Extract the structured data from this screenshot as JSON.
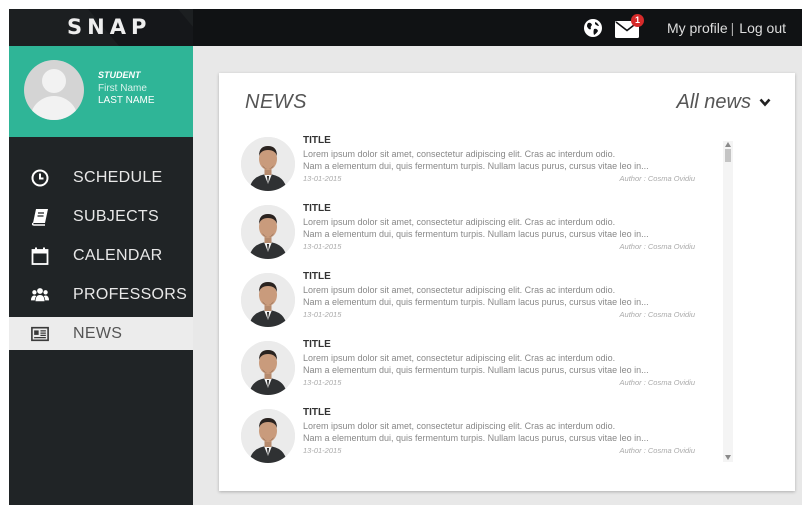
{
  "app": {
    "logo": "SNAP"
  },
  "topbar": {
    "globe_icon": "globe-icon",
    "mail_icon": "mail-icon",
    "notification_count": "1",
    "my_profile_label": "My profile",
    "separator": "|",
    "logout_label": "Log out"
  },
  "profile": {
    "role": "STUDENT",
    "first_name": "First Name",
    "last_name": "LAST NAME"
  },
  "sidebar": {
    "items": [
      {
        "label": "SCHEDULE",
        "icon": "clock-icon"
      },
      {
        "label": "SUBJECTS",
        "icon": "book-icon"
      },
      {
        "label": "CALENDAR",
        "icon": "calendar-icon"
      },
      {
        "label": "PROFESSORS",
        "icon": "users-icon"
      },
      {
        "label": "NEWS",
        "icon": "newspaper-icon",
        "active": true
      }
    ]
  },
  "main": {
    "title": "NEWS",
    "filter_label": "All news",
    "news": [
      {
        "title": "TITLE",
        "line1": "Lorem ipsum dolor sit amet, consectetur adipiscing elit. Cras ac interdum odio.",
        "line2": "Nam a elementum dui, quis fermentum turpis. Nullam lacus purus, cursus vitae leo in...",
        "date": "13-01-2015",
        "author": "Author : Cosma Ovidiu"
      },
      {
        "title": "TITLE",
        "line1": "Lorem ipsum dolor sit amet, consectetur adipiscing elit. Cras ac interdum odio.",
        "line2": "Nam a elementum dui, quis fermentum turpis. Nullam lacus purus, cursus vitae leo in...",
        "date": "13-01-2015",
        "author": "Author : Cosma Ovidiu"
      },
      {
        "title": "TITLE",
        "line1": "Lorem ipsum dolor sit amet, consectetur adipiscing elit. Cras ac interdum odio.",
        "line2": "Nam a elementum dui, quis fermentum turpis. Nullam lacus purus, cursus vitae leo in...",
        "date": "13-01-2015",
        "author": "Author : Cosma Ovidiu"
      },
      {
        "title": "TITLE",
        "line1": "Lorem ipsum dolor sit amet, consectetur adipiscing elit. Cras ac interdum odio.",
        "line2": "Nam a elementum dui, quis fermentum turpis. Nullam lacus purus, cursus vitae leo in...",
        "date": "13-01-2015",
        "author": "Author : Cosma Ovidiu"
      },
      {
        "title": "TITLE",
        "line1": "Lorem ipsum dolor sit amet, consectetur adipiscing elit. Cras ac interdum odio.",
        "line2": "Nam a elementum dui, quis fermentum turpis. Nullam lacus purus, cursus vitae leo in...",
        "date": "13-01-2015",
        "author": "Author : Cosma Ovidiu"
      }
    ]
  },
  "colors": {
    "topbar": "#101214",
    "sidebar": "#202426",
    "accent": "#2fb597",
    "badge": "#d62a2a",
    "background": "#e8e8e8"
  }
}
